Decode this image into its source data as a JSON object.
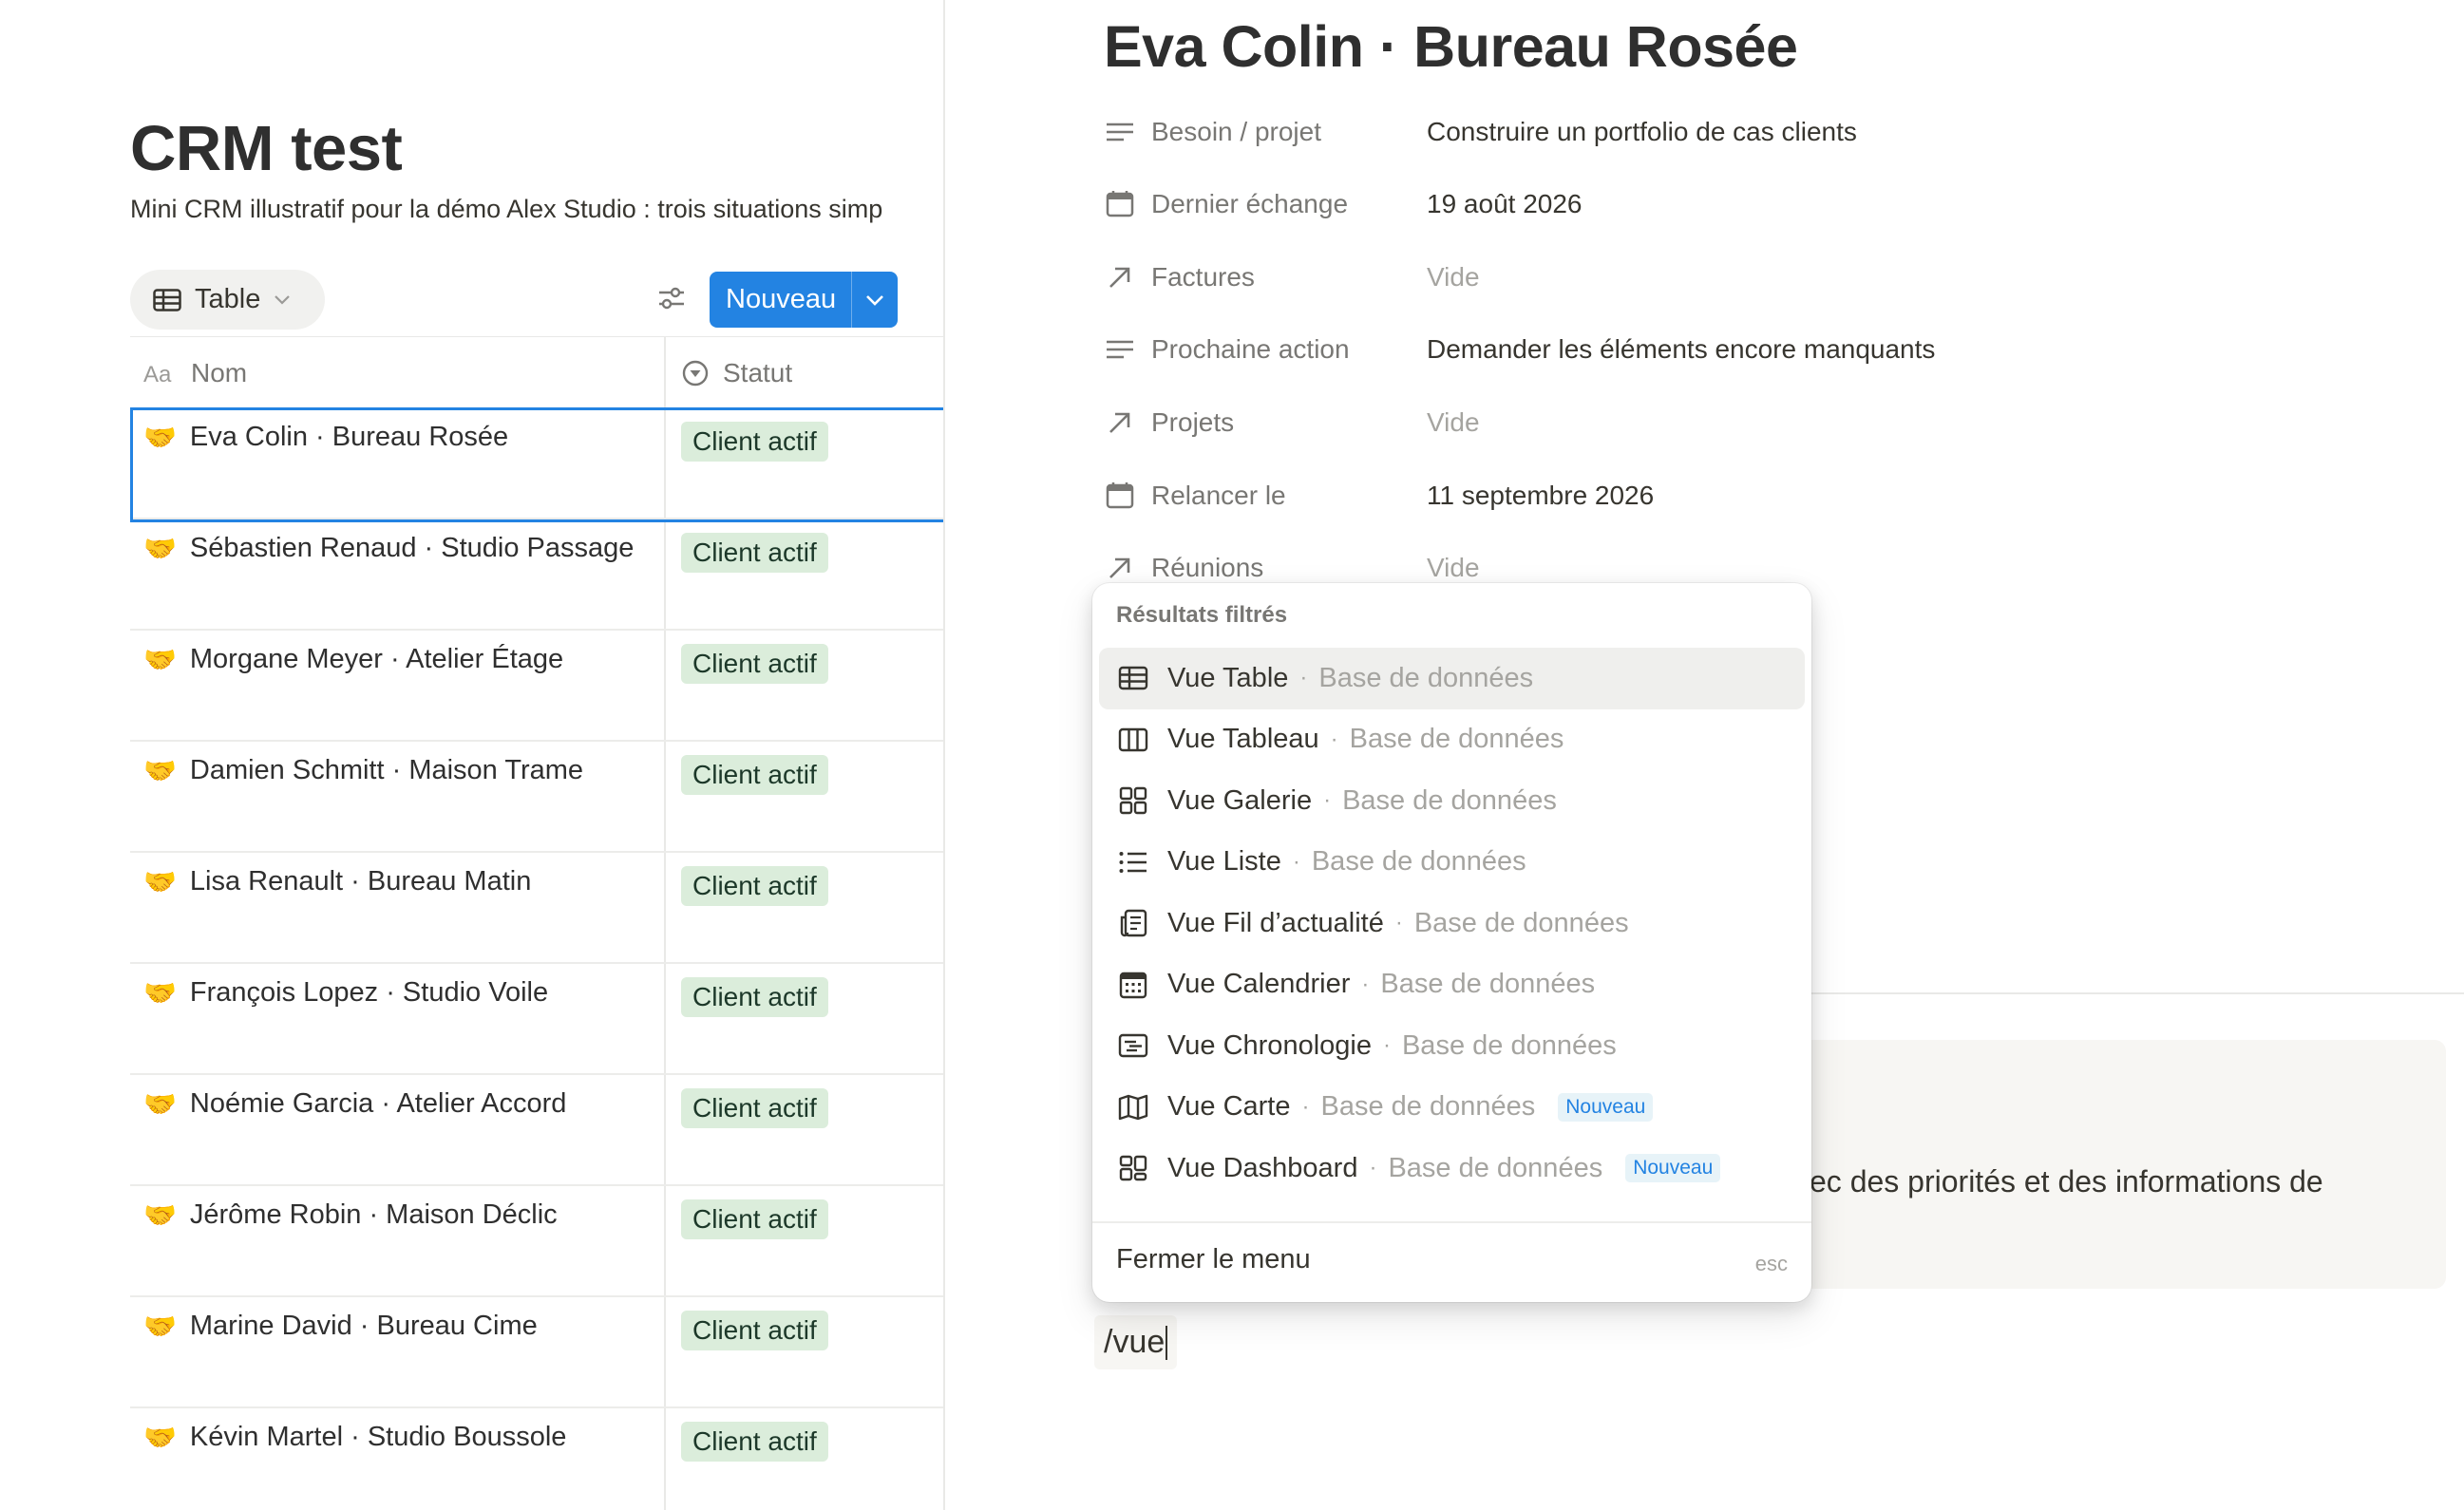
{
  "left": {
    "title": "CRM test",
    "description": "Mini CRM illustratif pour la démo Alex Studio : trois situations simp",
    "view_tab": "Table",
    "new_button": "Nouveau",
    "columns": [
      "Nom",
      "Statut"
    ],
    "rows": [
      {
        "emoji": "🤝",
        "name": "Eva Colin · Bureau Rosée",
        "status": "Client actif"
      },
      {
        "emoji": "🤝",
        "name": "Sébastien Renaud · Studio Passage",
        "status": "Client actif"
      },
      {
        "emoji": "🤝",
        "name": "Morgane Meyer · Atelier Étage",
        "status": "Client actif"
      },
      {
        "emoji": "🤝",
        "name": "Damien Schmitt · Maison Trame",
        "status": "Client actif"
      },
      {
        "emoji": "🤝",
        "name": "Lisa Renault · Bureau Matin",
        "status": "Client actif"
      },
      {
        "emoji": "🤝",
        "name": "François Lopez · Studio Voile",
        "status": "Client actif"
      },
      {
        "emoji": "🤝",
        "name": "Noémie Garcia · Atelier Accord",
        "status": "Client actif"
      },
      {
        "emoji": "🤝",
        "name": "Jérôme Robin · Maison Déclic",
        "status": "Client actif"
      },
      {
        "emoji": "🤝",
        "name": "Marine David · Bureau Cime",
        "status": "Client actif"
      },
      {
        "emoji": "🤝",
        "name": "Kévin Martel · Studio Boussole",
        "status": "Client actif"
      }
    ]
  },
  "page": {
    "title": "Eva Colin · Bureau Rosée",
    "properties": [
      {
        "icon": "text-lines-icon",
        "name": "Besoin / projet",
        "value": "Construire un portfolio de cas clients",
        "empty": false
      },
      {
        "icon": "calendar-icon",
        "name": "Dernier échange",
        "value": "19 août 2026",
        "empty": false
      },
      {
        "icon": "relation-arrow-icon",
        "name": "Factures",
        "value": "Vide",
        "empty": true
      },
      {
        "icon": "text-lines-icon",
        "name": "Prochaine action",
        "value": "Demander les éléments encore manquants",
        "empty": false
      },
      {
        "icon": "relation-arrow-icon",
        "name": "Projets",
        "value": "Vide",
        "empty": true
      },
      {
        "icon": "calendar-icon",
        "name": "Relancer le",
        "value": "11 septembre 2026",
        "empty": false
      },
      {
        "icon": "relation-arrow-icon",
        "name": "Réunions",
        "value": "Vide",
        "empty": true
      }
    ],
    "callout_text": "ec des priorités et des informations de",
    "slash_input": "/vue"
  },
  "menu": {
    "heading": "Résultats filtrés",
    "items": [
      {
        "icon": "table-view-icon",
        "label": "Vue Table",
        "sub": "Base de données",
        "badge": ""
      },
      {
        "icon": "board-view-icon",
        "label": "Vue Tableau",
        "sub": "Base de données",
        "badge": ""
      },
      {
        "icon": "gallery-view-icon",
        "label": "Vue Galerie",
        "sub": "Base de données",
        "badge": ""
      },
      {
        "icon": "list-view-icon",
        "label": "Vue Liste",
        "sub": "Base de données",
        "badge": ""
      },
      {
        "icon": "feed-view-icon",
        "label": "Vue Fil d’actualité",
        "sub": "Base de données",
        "badge": ""
      },
      {
        "icon": "calendar-view-icon",
        "label": "Vue Calendrier",
        "sub": "Base de données",
        "badge": ""
      },
      {
        "icon": "timeline-view-icon",
        "label": "Vue Chronologie",
        "sub": "Base de données",
        "badge": ""
      },
      {
        "icon": "map-view-icon",
        "label": "Vue Carte",
        "sub": "Base de données",
        "badge": "Nouveau"
      },
      {
        "icon": "dashboard-view-icon",
        "label": "Vue Dashboard",
        "sub": "Base de données",
        "badge": "Nouveau"
      }
    ],
    "close_label": "Fermer le menu",
    "close_hint": "esc"
  },
  "colors": {
    "accent": "#2383e2",
    "status_bg": "#dbeddb",
    "status_text": "#1c3829",
    "text": "#37352f",
    "muted": "#787774"
  }
}
